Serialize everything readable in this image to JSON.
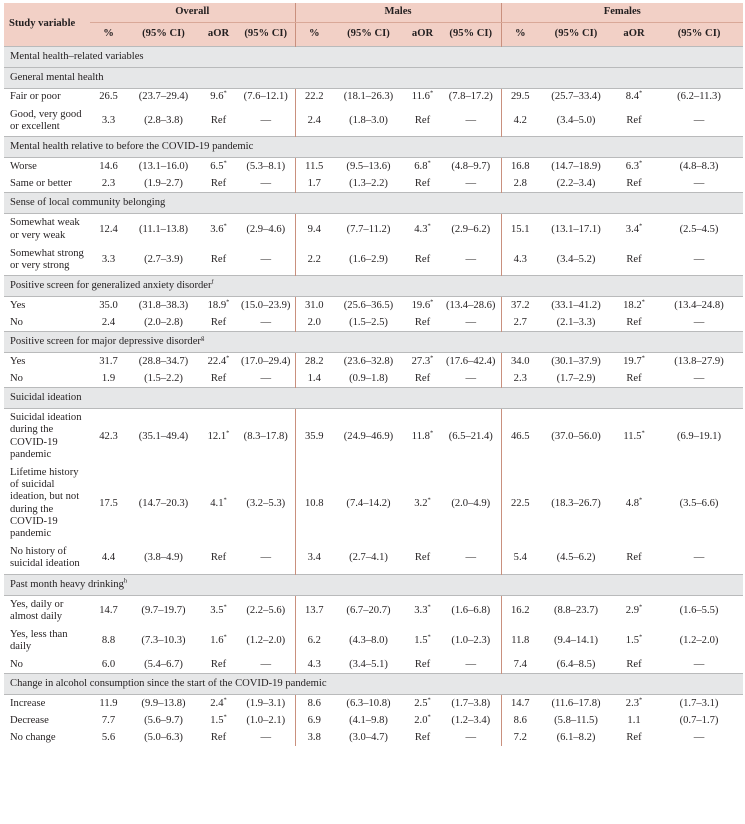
{
  "header": {
    "row_label": "Study variable",
    "groups": [
      "Overall",
      "Males",
      "Females"
    ],
    "subcols": [
      "%",
      "(95% CI)",
      "aOR",
      "(95% CI)"
    ]
  },
  "sections": [
    {
      "title": "Mental health–related variables",
      "rows": []
    },
    {
      "title": "General mental health",
      "rows": [
        {
          "label": "Fair or poor",
          "cells": [
            "26.5",
            "(23.7–29.4)",
            "9.6",
            "(7.6–12.1)",
            "22.2",
            "(18.1–26.3)",
            "11.6",
            "(7.8–17.2)",
            "29.5",
            "(25.7–33.4)",
            "8.4",
            "(6.2–11.3)"
          ],
          "sig": [
            true,
            true,
            true
          ]
        },
        {
          "label": "Good, very good or excellent",
          "cells": [
            "3.3",
            "(2.8–3.8)",
            "Ref",
            "—",
            "2.4",
            "(1.8–3.0)",
            "Ref",
            "—",
            "4.2",
            "(3.4–5.0)",
            "Ref",
            "—"
          ],
          "sig": [
            false,
            false,
            false
          ]
        }
      ]
    },
    {
      "title": "Mental health relative to before the COVID-19 pandemic",
      "rows": [
        {
          "label": "Worse",
          "cells": [
            "14.6",
            "(13.1–16.0)",
            "6.5",
            "(5.3–8.1)",
            "11.5",
            "(9.5–13.6)",
            "6.8",
            "(4.8–9.7)",
            "16.8",
            "(14.7–18.9)",
            "6.3",
            "(4.8–8.3)"
          ],
          "sig": [
            true,
            true,
            true
          ]
        },
        {
          "label": "Same or better",
          "cells": [
            "2.3",
            "(1.9–2.7)",
            "Ref",
            "—",
            "1.7",
            "(1.3–2.2)",
            "Ref",
            "—",
            "2.8",
            "(2.2–3.4)",
            "Ref",
            "—"
          ],
          "sig": [
            false,
            false,
            false
          ]
        }
      ]
    },
    {
      "title": "Sense of local community belonging",
      "rows": [
        {
          "label": "Somewhat weak or very weak",
          "cells": [
            "12.4",
            "(11.1–13.8)",
            "3.6",
            "(2.9–4.6)",
            "9.4",
            "(7.7–11.2)",
            "4.3",
            "(2.9–6.2)",
            "15.1",
            "(13.1–17.1)",
            "3.4",
            "(2.5–4.5)"
          ],
          "sig": [
            true,
            true,
            true
          ]
        },
        {
          "label": "Somewhat strong or very strong",
          "cells": [
            "3.3",
            "(2.7–3.9)",
            "Ref",
            "—",
            "2.2",
            "(1.6–2.9)",
            "Ref",
            "—",
            "4.3",
            "(3.4–5.2)",
            "Ref",
            "—"
          ],
          "sig": [
            false,
            false,
            false
          ]
        }
      ]
    },
    {
      "title": "Positive screen for generalized anxiety disorder",
      "title_sup": "f",
      "rows": [
        {
          "label": "Yes",
          "cells": [
            "35.0",
            "(31.8–38.3)",
            "18.9",
            "(15.0–23.9)",
            "31.0",
            "(25.6–36.5)",
            "19.6",
            "(13.4–28.6)",
            "37.2",
            "(33.1–41.2)",
            "18.2",
            "(13.4–24.8)"
          ],
          "sig": [
            true,
            true,
            true
          ]
        },
        {
          "label": "No",
          "cells": [
            "2.4",
            "(2.0–2.8)",
            "Ref",
            "—",
            "2.0",
            "(1.5–2.5)",
            "Ref",
            "—",
            "2.7",
            "(2.1–3.3)",
            "Ref",
            "—"
          ],
          "sig": [
            false,
            false,
            false
          ]
        }
      ]
    },
    {
      "title": "Positive screen for major depressive disorder",
      "title_sup": "g",
      "rows": [
        {
          "label": "Yes",
          "cells": [
            "31.7",
            "(28.8–34.7)",
            "22.4",
            "(17.0–29.4)",
            "28.2",
            "(23.6–32.8)",
            "27.3",
            "(17.6–42.4)",
            "34.0",
            "(30.1–37.9)",
            "19.7",
            "(13.8–27.9)"
          ],
          "sig": [
            true,
            true,
            true
          ]
        },
        {
          "label": "No",
          "cells": [
            "1.9",
            "(1.5–2.2)",
            "Ref",
            "—",
            "1.4",
            "(0.9–1.8)",
            "Ref",
            "—",
            "2.3",
            "(1.7–2.9)",
            "Ref",
            "—"
          ],
          "sig": [
            false,
            false,
            false
          ]
        }
      ]
    },
    {
      "title": "Suicidal ideation",
      "rows": [
        {
          "label": "Suicidal ideation during the COVID-19 pandemic",
          "cells": [
            "42.3",
            "(35.1–49.4)",
            "12.1",
            "(8.3–17.8)",
            "35.9",
            "(24.9–46.9)",
            "11.8",
            "(6.5–21.4)",
            "46.5",
            "(37.0–56.0)",
            "11.5",
            "(6.9–19.1)"
          ],
          "sig": [
            true,
            true,
            true
          ]
        },
        {
          "label": "Lifetime history of suicidal ideation, but not during the COVID-19 pandemic",
          "cells": [
            "17.5",
            "(14.7–20.3)",
            "4.1",
            "(3.2–5.3)",
            "10.8",
            "(7.4–14.2)",
            "3.2",
            "(2.0–4.9)",
            "22.5",
            "(18.3–26.7)",
            "4.8",
            "(3.5–6.6)"
          ],
          "sig": [
            true,
            true,
            true
          ]
        },
        {
          "label": "No history of suicidal ideation",
          "cells": [
            "4.4",
            "(3.8–4.9)",
            "Ref",
            "—",
            "3.4",
            "(2.7–4.1)",
            "Ref",
            "—",
            "5.4",
            "(4.5–6.2)",
            "Ref",
            "—"
          ],
          "sig": [
            false,
            false,
            false
          ]
        }
      ]
    },
    {
      "title": "Past month heavy drinking",
      "title_sup": "h",
      "rows": [
        {
          "label": "Yes, daily or almost daily",
          "cells": [
            "14.7",
            "(9.7–19.7)",
            "3.5",
            "(2.2–5.6)",
            "13.7",
            "(6.7–20.7)",
            "3.3",
            "(1.6–6.8)",
            "16.2",
            "(8.8–23.7)",
            "2.9",
            "(1.6–5.5)"
          ],
          "sig": [
            true,
            true,
            true
          ]
        },
        {
          "label": "Yes, less than daily",
          "cells": [
            "8.8",
            "(7.3–10.3)",
            "1.6",
            "(1.2–2.0)",
            "6.2",
            "(4.3–8.0)",
            "1.5",
            "(1.0–2.3)",
            "11.8",
            "(9.4–14.1)",
            "1.5",
            "(1.2–2.0)"
          ],
          "sig": [
            true,
            true,
            true
          ]
        },
        {
          "label": "No",
          "cells": [
            "6.0",
            "(5.4–6.7)",
            "Ref",
            "—",
            "4.3",
            "(3.4–5.1)",
            "Ref",
            "—",
            "7.4",
            "(6.4–8.5)",
            "Ref",
            "—"
          ],
          "sig": [
            false,
            false,
            false
          ]
        }
      ]
    },
    {
      "title": "Change in alcohol consumption since the start of the COVID-19 pandemic",
      "rows": [
        {
          "label": "Increase",
          "cells": [
            "11.9",
            "(9.9–13.8)",
            "2.4",
            "(1.9–3.1)",
            "8.6",
            "(6.3–10.8)",
            "2.5",
            "(1.7–3.8)",
            "14.7",
            "(11.6–17.8)",
            "2.3",
            "(1.7–3.1)"
          ],
          "sig": [
            true,
            true,
            true
          ]
        },
        {
          "label": "Decrease",
          "cells": [
            "7.7",
            "(5.6–9.7)",
            "1.5",
            "(1.0–2.1)",
            "6.9",
            "(4.1–9.8)",
            "2.0",
            "(1.2–3.4)",
            "8.6",
            "(5.8–11.5)",
            "1.1",
            "(0.7–1.7)"
          ],
          "sig": [
            true,
            true,
            false
          ]
        },
        {
          "label": "No change",
          "cells": [
            "5.6",
            "(5.0–6.3)",
            "Ref",
            "—",
            "3.8",
            "(3.0–4.7)",
            "Ref",
            "—",
            "7.2",
            "(6.1–8.2)",
            "Ref",
            "—"
          ],
          "sig": [
            false,
            false,
            false
          ]
        }
      ]
    }
  ],
  "marks": {
    "significance": "*"
  }
}
